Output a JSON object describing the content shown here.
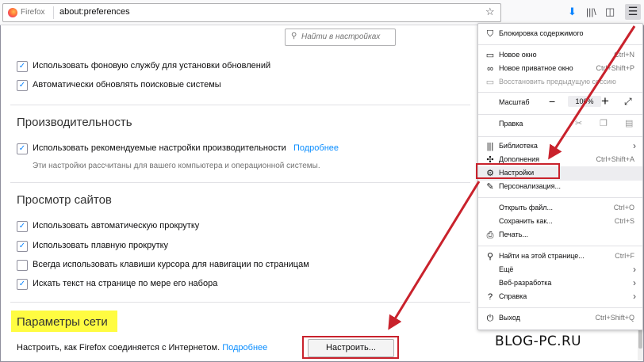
{
  "browser": {
    "identity_label": "Firefox",
    "url": "about:preferences",
    "menu_button_icon": "hamburger-icon"
  },
  "search": {
    "placeholder": "Найти в настройках"
  },
  "updates": {
    "option1": "Использовать фоновую службу для установки обновлений",
    "option2": "Автоматически обновлять поисковые системы"
  },
  "performance": {
    "heading": "Производительность",
    "option": "Использовать рекомендуемые настройки производительности",
    "link": "Подробнее",
    "note": "Эти настройки рассчитаны для вашего компьютера и операционной системы."
  },
  "browsing": {
    "heading": "Просмотр сайтов",
    "options": [
      {
        "label": "Использовать автоматическую прокрутку",
        "checked": true
      },
      {
        "label": "Использовать плавную прокрутку",
        "checked": true
      },
      {
        "label": "Всегда использовать клавиши курсора для навигации по страницам",
        "checked": false
      },
      {
        "label": "Искать текст на странице по мере его набора",
        "checked": true
      }
    ]
  },
  "network": {
    "heading": "Параметры сети",
    "text": "Настроить, как Firefox соединяется с Интернетом.",
    "link": "Подробнее",
    "button": "Настроить...",
    "highlight_color": "#fffc41"
  },
  "menu": {
    "content_blocking": "Блокировка содержимого",
    "new_window": "Новое окно",
    "new_window_shortcut": "Ctrl+N",
    "new_private": "Новое приватное окно",
    "new_private_shortcut": "Ctrl+Shift+P",
    "restore_session": "Восстановить предыдущую сессию",
    "zoom_label": "Масштаб",
    "zoom_minus": "−",
    "zoom_value": "100%",
    "zoom_plus": "+",
    "edit_label": "Правка",
    "library": "Библиотека",
    "addons": "Дополнения",
    "addons_shortcut": "Ctrl+Shift+A",
    "settings": "Настройки",
    "customize": "Персонализация...",
    "open_file": "Открыть файл...",
    "open_file_shortcut": "Ctrl+O",
    "save_as": "Сохранить как...",
    "save_as_shortcut": "Ctrl+S",
    "print": "Печать...",
    "find": "Найти на этой странице...",
    "find_shortcut": "Ctrl+F",
    "more": "Ещё",
    "web_dev": "Веб-разработка",
    "help": "Справка",
    "exit": "Выход",
    "exit_shortcut": "Ctrl+Shift+Q"
  },
  "watermark": "BLOG-PC.RU",
  "colors": {
    "accent": "#0a84ff",
    "link": "#0a8dff",
    "annotation_red": "#c9222c"
  }
}
